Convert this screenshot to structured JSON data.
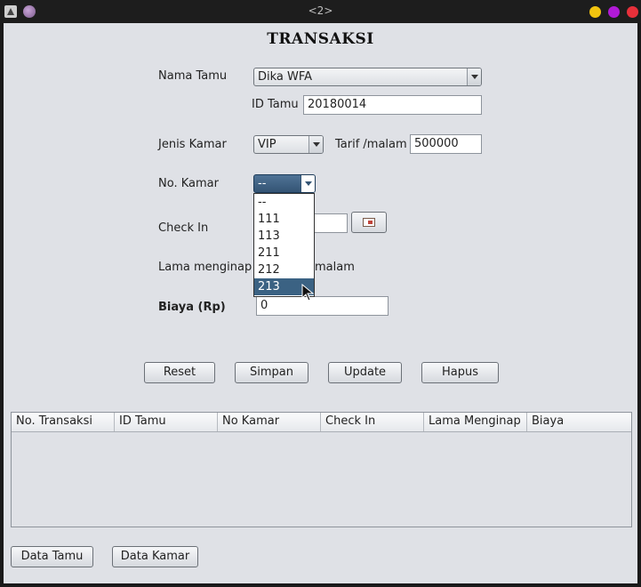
{
  "window": {
    "title": "<2>"
  },
  "form": {
    "heading": "TRANSAKSI",
    "nama_tamu": {
      "label": "Nama Tamu",
      "value": "Dika WFA"
    },
    "id_tamu": {
      "label": "ID Tamu",
      "value": "20180014"
    },
    "jenis_kamar": {
      "label": "Jenis Kamar",
      "value": "VIP"
    },
    "tarif": {
      "label": "Tarif /malam",
      "value": "500000"
    },
    "no_kamar": {
      "label": "No. Kamar",
      "value": "--",
      "options": [
        "--",
        "111",
        "113",
        "211",
        "212",
        "213"
      ],
      "highlighted": "213"
    },
    "check_in": {
      "label": "Check In",
      "value": ""
    },
    "lama_menginap": {
      "label": "Lama menginap",
      "unit": "malam"
    },
    "biaya": {
      "label": "Biaya (Rp)",
      "value": "0"
    }
  },
  "buttons": {
    "reset": "Reset",
    "simpan": "Simpan",
    "update": "Update",
    "hapus": "Hapus",
    "data_tamu": "Data Tamu",
    "data_kamar": "Data Kamar"
  },
  "table": {
    "columns": [
      "No. Transaksi",
      "ID Tamu",
      "No Kamar",
      "Check In",
      "Lama Menginap",
      "Biaya"
    ],
    "rows": []
  },
  "colors": {
    "selection": "#3b6283",
    "background": "#dfe1e6"
  }
}
